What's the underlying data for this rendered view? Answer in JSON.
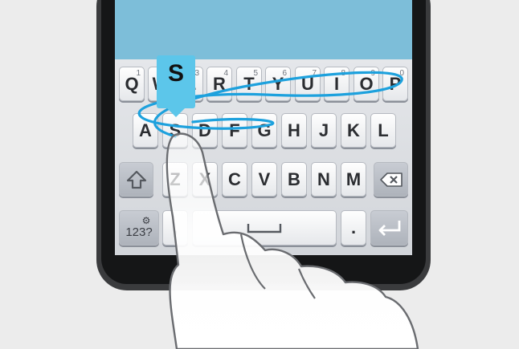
{
  "keyboard": {
    "row1": [
      {
        "label": "Q",
        "sub": "1"
      },
      {
        "label": "W",
        "sub": "2"
      },
      {
        "label": "E",
        "sub": "3"
      },
      {
        "label": "R",
        "sub": "4"
      },
      {
        "label": "T",
        "sub": "5"
      },
      {
        "label": "Y",
        "sub": "6"
      },
      {
        "label": "U",
        "sub": "7"
      },
      {
        "label": "I",
        "sub": "8"
      },
      {
        "label": "O",
        "sub": "9"
      },
      {
        "label": "P",
        "sub": "0"
      }
    ],
    "row2": [
      "A",
      "S",
      "D",
      "F",
      "G",
      "H",
      "J",
      "K",
      "L"
    ],
    "row3": [
      "Z",
      "X",
      "C",
      "V",
      "B",
      "N",
      "M"
    ],
    "symbols_key": "123?",
    "comma": ",",
    "period": ".",
    "key_popup": "S"
  },
  "icons": {
    "shift": "shift-icon",
    "backspace": "backspace-icon",
    "settings": "gear-icon",
    "space": "space-icon",
    "enter": "enter-icon",
    "gesture": "hand-pointer-icon"
  },
  "colors": {
    "accent": "#1da1dd",
    "popup": "#5cc6ea",
    "display": "#7dbed9"
  }
}
